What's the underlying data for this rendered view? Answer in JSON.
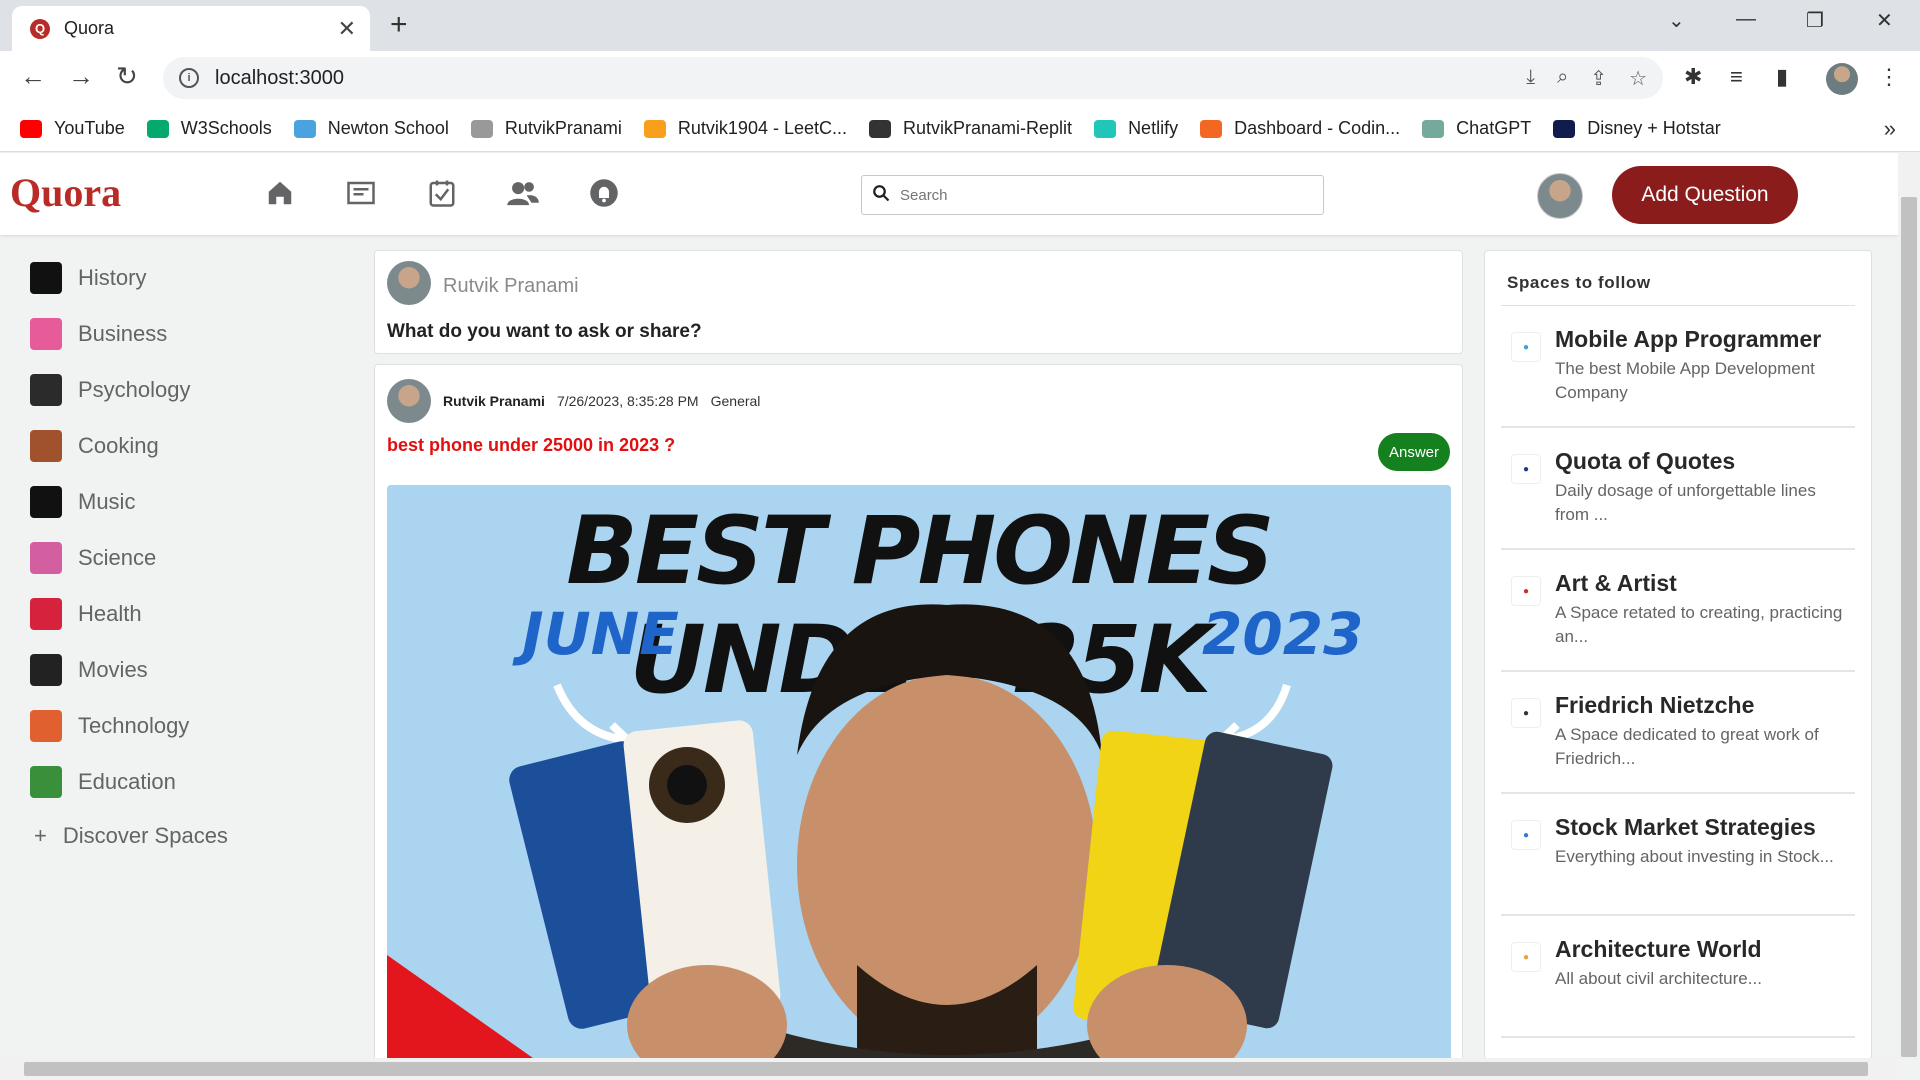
{
  "browser": {
    "tab_title": "Quora",
    "url": "localhost:3000",
    "bookmarks": [
      {
        "label": "YouTube",
        "color": "#ff0000"
      },
      {
        "label": "W3Schools",
        "color": "#04aa6d"
      },
      {
        "label": "Newton School",
        "color": "#4aa3df"
      },
      {
        "label": "RutvikPranami",
        "color": "#999999"
      },
      {
        "label": "Rutvik1904 - LeetC...",
        "color": "#f89f1b"
      },
      {
        "label": "RutvikPranami-Replit",
        "color": "#333333"
      },
      {
        "label": "Netlify",
        "color": "#20c6b7"
      },
      {
        "label": "Dashboard - Codin...",
        "color": "#f26722"
      },
      {
        "label": "ChatGPT",
        "color": "#74aa9c"
      },
      {
        "label": "Disney + Hotstar",
        "color": "#0f1c4d"
      }
    ]
  },
  "header": {
    "logo": "Quora",
    "search_placeholder": "Search",
    "add_question": "Add Question"
  },
  "sidebar": {
    "items": [
      {
        "label": "History",
        "color": "#111111"
      },
      {
        "label": "Business",
        "color": "#e85b9a"
      },
      {
        "label": "Psychology",
        "color": "#2b2b2b"
      },
      {
        "label": "Cooking",
        "color": "#a0522d"
      },
      {
        "label": "Music",
        "color": "#111111"
      },
      {
        "label": "Science",
        "color": "#d45fa0"
      },
      {
        "label": "Health",
        "color": "#d6223c"
      },
      {
        "label": "Movies",
        "color": "#222222"
      },
      {
        "label": "Technology",
        "color": "#e06030"
      },
      {
        "label": "Education",
        "color": "#3a8f3a"
      }
    ],
    "discover": "Discover Spaces"
  },
  "feed": {
    "ask_box": {
      "user": "Rutvik Pranami",
      "prompt": "What do you want to ask or share?"
    },
    "post": {
      "author": "Rutvik Pranami",
      "timestamp": "7/26/2023, 8:35:28 PM",
      "category": "General",
      "question": "best phone under 25000 in 2023 ?",
      "answer_label": "Answer",
      "image": {
        "headline": "BEST PHONES UNDER 25K",
        "left_tag": "JUNE",
        "right_tag": "2023"
      }
    }
  },
  "spaces": {
    "title": "Spaces to follow",
    "items": [
      {
        "title": "Mobile App Programmer",
        "desc": "The best Mobile App Development Company"
      },
      {
        "title": "Quota of Quotes",
        "desc": "Daily dosage of unforgettable lines from ..."
      },
      {
        "title": "Art & Artist",
        "desc": "A Space retated to creating, practicing an..."
      },
      {
        "title": "Friedrich Nietzche",
        "desc": "A Space dedicated to great work of Friedrich..."
      },
      {
        "title": "Stock Market Strategies",
        "desc": "Everything about investing in Stock..."
      },
      {
        "title": "Architecture World",
        "desc": "All about civil architecture..."
      }
    ]
  }
}
